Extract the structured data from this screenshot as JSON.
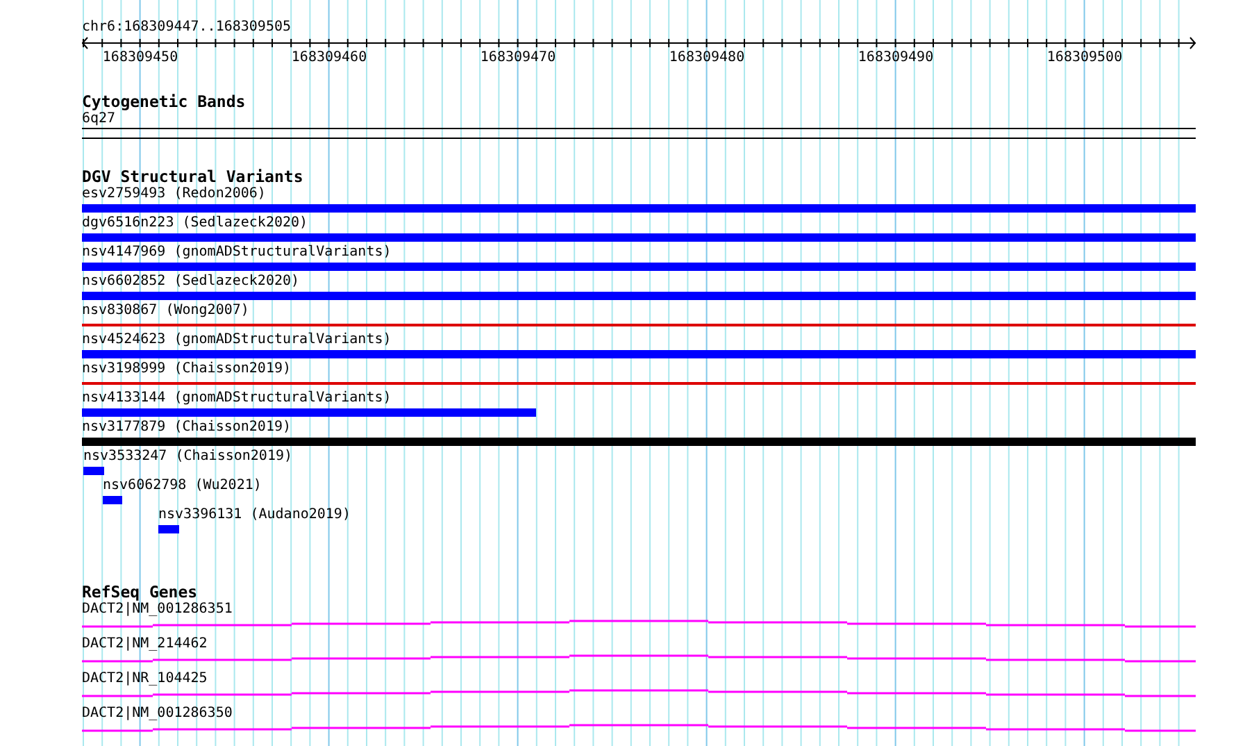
{
  "location": "chr6:168309447..168309505",
  "ruler": {
    "labels": [
      "168309450",
      "168309460",
      "168309470",
      "168309480",
      "168309490",
      "168309500"
    ]
  },
  "tracks": [
    {
      "kind": "cytoband",
      "title": "Cytogenetic Bands",
      "features": [
        {
          "label": "6q27"
        }
      ]
    },
    {
      "kind": "variants",
      "title": "DGV Structural Variants",
      "features": [
        {
          "label": "esv2759493 (Redon2006)",
          "kind": "bar",
          "color": "#0000ff"
        },
        {
          "label": "dgv6516n223 (Sedlazeck2020)",
          "kind": "bar",
          "color": "#0000ff"
        },
        {
          "label": "nsv4147969 (gnomADStructuralVariants)",
          "kind": "bar",
          "color": "#0000ff"
        },
        {
          "label": "nsv6602852 (Sedlazeck2020)",
          "kind": "bar",
          "color": "#0000ff"
        },
        {
          "label": "nsv830867 (Wong2007)",
          "kind": "line",
          "color": "#dd0000"
        },
        {
          "label": "nsv4524623 (gnomADStructuralVariants)",
          "kind": "bar",
          "color": "#0000ff"
        },
        {
          "label": "nsv3198999 (Chaisson2019)",
          "kind": "line",
          "color": "#dd0000"
        },
        {
          "label": "nsv4133144 (gnomADStructuralVariants)",
          "kind": "bar",
          "color": "#0000ff"
        },
        {
          "label": "nsv3177879 (Chaisson2019)",
          "kind": "bar",
          "color": "#000000"
        },
        {
          "label": "nsv3533247 (Chaisson2019)",
          "kind": "bar",
          "color": "#0000ff"
        },
        {
          "label": "nsv6062798 (Wu2021)",
          "kind": "bar",
          "color": "#0000ff"
        },
        {
          "label": "nsv3396131 (Audano2019)",
          "kind": "bar",
          "color": "#0000ff"
        }
      ]
    },
    {
      "kind": "genes",
      "title": "RefSeq Genes",
      "features": [
        {
          "label": "DACT2|NM_001286351",
          "color": "#ff00ff"
        },
        {
          "label": "DACT2|NM_214462",
          "color": "#ff00ff"
        },
        {
          "label": "DACT2|NR_104425",
          "color": "#ff00ff"
        },
        {
          "label": "DACT2|NM_001286350",
          "color": "#ff00ff"
        }
      ]
    }
  ]
}
